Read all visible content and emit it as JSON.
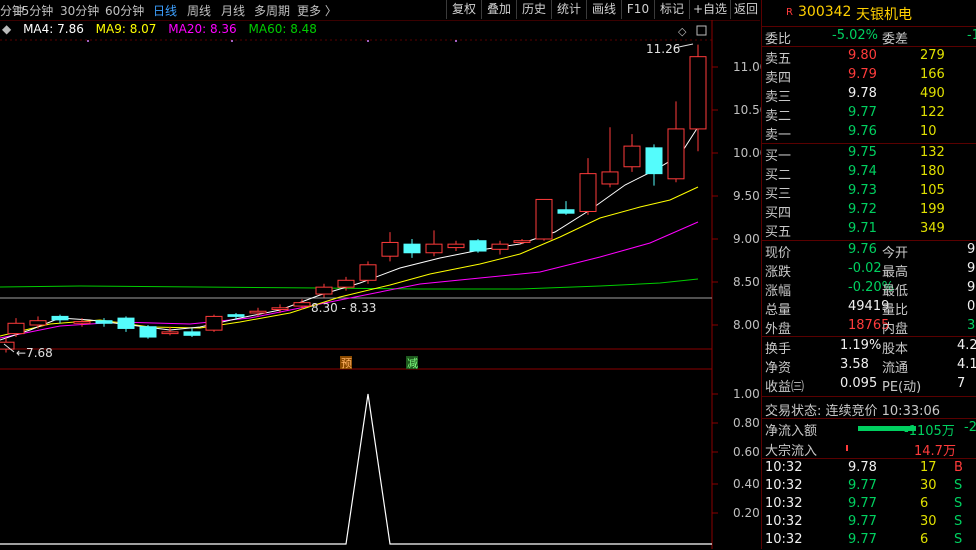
{
  "toolbar": {
    "periods": [
      "分钟",
      "15分钟",
      "30分钟",
      "60分钟",
      "日线",
      "周线",
      "月线",
      "多周期",
      "更多 〉"
    ],
    "active_period": "日线",
    "buttons": [
      "复权",
      "叠加",
      "历史",
      "统计",
      "画线",
      "F10",
      "标记",
      "+自选",
      "返回"
    ]
  },
  "ma_legend": {
    "ma4": "MA4: 7.86",
    "ma9": "MA9: 8.07",
    "ma20": "MA20: 8.36",
    "ma60": "MA60: 8.48",
    "colors": {
      "ma4": "#ffffff",
      "ma9": "#ffff00",
      "ma20": "#ff00ff",
      "ma60": "#00cc00"
    }
  },
  "price_axis": [
    "11.00",
    "10.50",
    "10.00",
    "9.50",
    "9.00",
    "8.50",
    "8.00"
  ],
  "indicator_axis": [
    "1.00",
    "0.80",
    "0.60",
    "0.40",
    "0.20"
  ],
  "annotations": {
    "high": "11.26",
    "low": "←7.68",
    "mid": "8.30 - 8.33",
    "tag_pre": "预",
    "tag_minus": "减"
  },
  "stock": {
    "flag": "R",
    "code": "300342",
    "name": "天银机电"
  },
  "ratio": {
    "label_wb": "委比",
    "wb": "-5.02%",
    "label_wc": "委差",
    "wc": "-1"
  },
  "asks": [
    {
      "label": "卖五",
      "price": "9.80",
      "vol": "279"
    },
    {
      "label": "卖四",
      "price": "9.79",
      "vol": "166"
    },
    {
      "label": "卖三",
      "price": "9.78",
      "vol": "490"
    },
    {
      "label": "卖二",
      "price": "9.77",
      "vol": "122"
    },
    {
      "label": "卖一",
      "price": "9.76",
      "vol": "10"
    }
  ],
  "bids": [
    {
      "label": "买一",
      "price": "9.75",
      "vol": "132"
    },
    {
      "label": "买二",
      "price": "9.74",
      "vol": "180"
    },
    {
      "label": "买三",
      "price": "9.73",
      "vol": "105"
    },
    {
      "label": "买四",
      "price": "9.72",
      "vol": "199"
    },
    {
      "label": "买五",
      "price": "9.71",
      "vol": "349"
    }
  ],
  "quote": [
    {
      "l1": "现价",
      "v1": "9.76",
      "l2": "今开",
      "v2": "9"
    },
    {
      "l1": "涨跌",
      "v1": "-0.02",
      "l2": "最高",
      "v2": "9"
    },
    {
      "l1": "涨幅",
      "v1": "-0.20%",
      "l2": "最低",
      "v2": "9"
    },
    {
      "l1": "总量",
      "v1": "49419",
      "l2": "量比",
      "v2": "0"
    },
    {
      "l1": "外盘",
      "v1": "18765",
      "l2": "内盘",
      "v2": "306"
    }
  ],
  "stats": [
    {
      "l1": "换手",
      "v1": "1.19%",
      "l2": "股本",
      "v2": "4.2"
    },
    {
      "l1": "净资",
      "v1": "3.58",
      "l2": "流通",
      "v2": "4.1"
    },
    {
      "l1": "收益㈢",
      "v1": "0.095",
      "l2": "PE(动)",
      "v2": "7"
    }
  ],
  "trade_state": "交易状态: 连续竞价 10:33:06",
  "flows": [
    {
      "label": "净流入额",
      "value": "-1105万",
      "extra": "-2"
    },
    {
      "label": "大宗流入",
      "value": "14.7万",
      "extra": ""
    }
  ],
  "ticks": [
    {
      "time": "10:32",
      "price": "9.78",
      "vol": "17",
      "side": "B"
    },
    {
      "time": "10:32",
      "price": "9.77",
      "vol": "30",
      "side": "S"
    },
    {
      "time": "10:32",
      "price": "9.77",
      "vol": "6",
      "side": "S"
    },
    {
      "time": "10:32",
      "price": "9.77",
      "vol": "30",
      "side": "S"
    },
    {
      "time": "10:32",
      "price": "9.77",
      "vol": "6",
      "side": "S"
    }
  ],
  "colors": {
    "up": "#ff3b3b",
    "down": "#54fcfc",
    "neutral": "#ffffff"
  }
}
